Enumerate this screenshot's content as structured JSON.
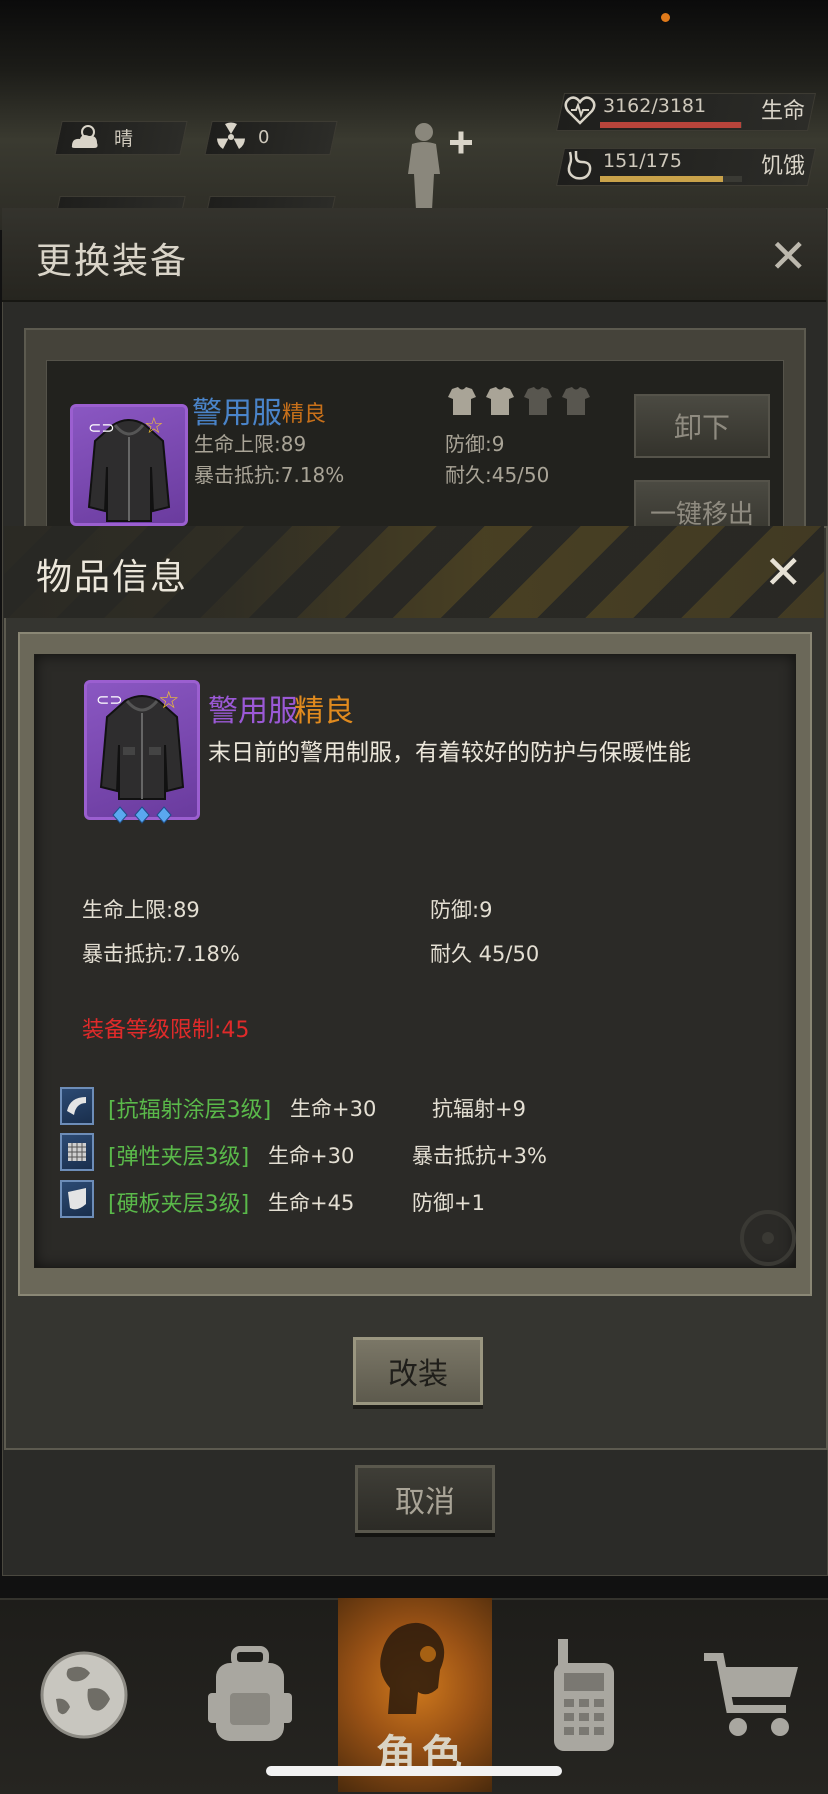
{
  "hud": {
    "weather": "晴",
    "radiation": "0",
    "hp_value": "3162/3181",
    "hp_label": "生命",
    "hp_fraction": 0.994,
    "hunger_value": "151/175",
    "hunger_label": "饥饿",
    "hunger_fraction": 0.863
  },
  "back_panel": {
    "title": "更换装备",
    "item_name": "警用服",
    "item_quality": "精良",
    "stat_hp": "生命上限:89",
    "stat_crit_res": "暴击抵抗:7.18%",
    "stat_def": "防御:9",
    "stat_durability": "耐久:45/50",
    "unequip_label": "卸下",
    "remove_all_label": "一键移出"
  },
  "item_info": {
    "title": "物品信息",
    "name": "警用服",
    "quality": "精良",
    "description": "末日前的警用制服，有着较好的防护与保暖性能",
    "stat_hp": "生命上限:89",
    "stat_def": "防御:9",
    "stat_crit_res": "暴击抵抗:7.18%",
    "stat_durability": "耐久 45/50",
    "level_limit": "装备等级限制:45",
    "mods": [
      {
        "name": "[抗辐射涂层3级]",
        "stat1": "生命+30",
        "stat2": "抗辐射+9"
      },
      {
        "name": "[弹性夹层3级]",
        "stat1": "生命+30",
        "stat2": "暴击抵抗+3%"
      },
      {
        "name": "[硬板夹层3级]",
        "stat1": "生命+45",
        "stat2": "防御+1"
      }
    ],
    "modify_label": "改装",
    "cancel_label": "取消"
  },
  "nav": {
    "active_label": "角色",
    "items": [
      "world-icon",
      "backpack-icon",
      "character-icon",
      "radio-icon",
      "shop-icon"
    ]
  },
  "colors": {
    "name_purple": "#9b59d6",
    "quality_orange": "#e08a1e",
    "mod_green": "#5ab94a",
    "limit_red": "#e02a2a",
    "accent_orange": "#d07a1d"
  }
}
